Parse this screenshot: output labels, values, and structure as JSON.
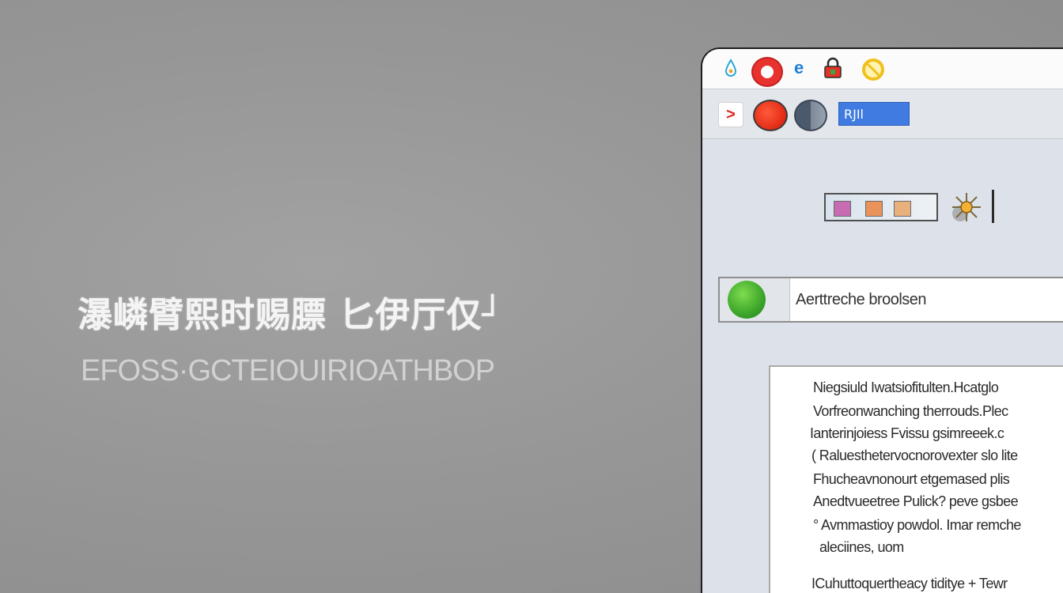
{
  "promo": {
    "title": "瀑嶙臂熙时赐膘 匕伊厅仅┘",
    "subtitle": "EFOSS·GCTEIOUIRIOATHBOP"
  },
  "toolbar": {
    "address_value": "RJIl",
    "play_glyph": ">"
  },
  "titlebar": {
    "e_glyph": "e"
  },
  "search": {
    "value": "Aerttreche broolsen"
  },
  "document": {
    "lines": [
      "Niegsiuld Iwatsiofitulten.Hcatglo",
      "Vorfreonwanching therrouds.Plec",
      "Ianterinjoiess Fvissu gsimreeek.c",
      "( Raluesthetervocnorovexter slo lite",
      "Fhucheavnonourt etgemased plis",
      "Anedtvueetree Pulick? peve gsbee",
      "° Avmmastioy powdol. Imar remche",
      "aleciines, uom",
      "ICuhuttoquertheacy tiditye + Tewr"
    ]
  },
  "colors": {
    "accent_blue": "#3f7be0",
    "go_green": "#3ca52a",
    "record_red": "#e12a14"
  }
}
